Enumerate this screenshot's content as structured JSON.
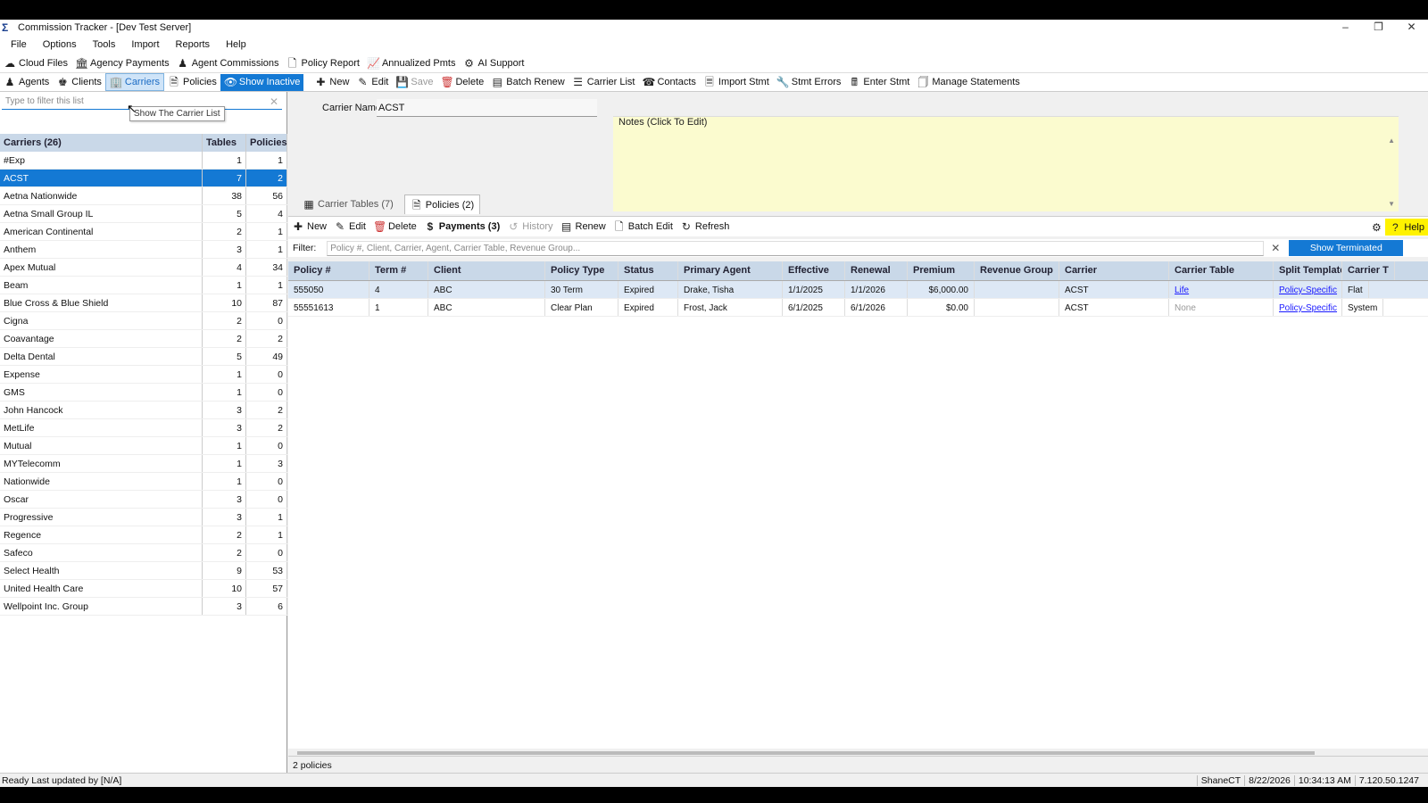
{
  "window": {
    "title": "Commission Tracker - [Dev Test Server]",
    "controls": [
      "–",
      "❐",
      "✕"
    ]
  },
  "menu": [
    "File",
    "Options",
    "Tools",
    "Import",
    "Reports",
    "Help"
  ],
  "toolbar1": [
    "Cloud Files",
    "Agency Payments",
    "Agent Commissions",
    "Policy Report",
    "Annualized Pmts",
    "AI Support"
  ],
  "toolbar2": {
    "left": [
      "Agents",
      "Clients",
      "Carriers",
      "Policies",
      "Show Inactive"
    ],
    "right": [
      "New",
      "Edit",
      "Save",
      "Delete",
      "Batch Renew",
      "Carrier List",
      "Contacts",
      "Import Stmt",
      "Stmt Errors",
      "Enter Stmt",
      "Manage Statements"
    ]
  },
  "left_panel": {
    "filter_placeholder": "Type to filter this list",
    "tooltip": "Show The Carrier List",
    "headers": [
      "Carriers (26)",
      "Tables",
      "Policies"
    ],
    "selected_index": 1,
    "rows": [
      [
        "#Exp",
        "1",
        "1"
      ],
      [
        "ACST",
        "7",
        "2"
      ],
      [
        "Aetna Nationwide",
        "38",
        "56"
      ],
      [
        "Aetna Small Group IL",
        "5",
        "4"
      ],
      [
        "American Continental",
        "2",
        "1"
      ],
      [
        "Anthem",
        "3",
        "1"
      ],
      [
        "Apex Mutual",
        "4",
        "34"
      ],
      [
        "Beam",
        "1",
        "1"
      ],
      [
        "Blue Cross & Blue Shield",
        "10",
        "87"
      ],
      [
        "Cigna",
        "2",
        "0"
      ],
      [
        "Coavantage",
        "2",
        "2"
      ],
      [
        "Delta Dental",
        "5",
        "49"
      ],
      [
        "Expense",
        "1",
        "0"
      ],
      [
        "GMS",
        "1",
        "0"
      ],
      [
        "John Hancock",
        "3",
        "2"
      ],
      [
        "MetLife",
        "3",
        "2"
      ],
      [
        "Mutual",
        "1",
        "0"
      ],
      [
        "MYTelecomm",
        "1",
        "3"
      ],
      [
        "Nationwide",
        "1",
        "0"
      ],
      [
        "Oscar",
        "3",
        "0"
      ],
      [
        "Progressive",
        "3",
        "1"
      ],
      [
        "Regence",
        "2",
        "1"
      ],
      [
        "Safeco",
        "2",
        "0"
      ],
      [
        "Select Health",
        "9",
        "53"
      ],
      [
        "United Health Care",
        "10",
        "57"
      ],
      [
        "Wellpoint Inc. Group",
        "3",
        "6"
      ]
    ]
  },
  "detail": {
    "carrier_name_label": "Carrier Name:",
    "carrier_name_value": "ACST",
    "notes_label": "Notes  (Click To Edit)",
    "tabs": [
      "Carrier Tables (7)",
      "Policies (2)"
    ]
  },
  "policy_toolbar": [
    "New",
    "Edit",
    "Delete",
    "Payments (3)",
    "History",
    "Renew",
    "Batch Edit",
    "Refresh"
  ],
  "help_label": "Help",
  "filter": {
    "label": "Filter:",
    "placeholder": "Policy #, Client, Carrier, Agent, Carrier Table, Revenue Group...",
    "show_terminated": "Show Terminated"
  },
  "grid": {
    "headers": [
      "Policy #",
      "Term #",
      "Client",
      "Policy Type",
      "Status",
      "Primary Agent",
      "Effective",
      "Renewal",
      "Premium",
      "Revenue Group",
      "Carrier",
      "Carrier Table",
      "Split Template",
      "Carrier T"
    ],
    "rows": [
      [
        "555050",
        "4",
        "ABC",
        "30 Term",
        "Expired",
        "Drake, Tisha",
        "1/1/2025",
        "1/1/2026",
        "$6,000.00",
        "",
        "ACST",
        "Life",
        "Policy-Specific",
        "Flat"
      ],
      [
        "55551613",
        "1",
        "ABC",
        "Clear Plan",
        "Expired",
        "Frost, Jack",
        "6/1/2025",
        "6/1/2026",
        "$0.00",
        "",
        "ACST",
        "None",
        "Policy-Specific",
        "System"
      ]
    ],
    "footer": "2 policies"
  },
  "status": {
    "left": "Ready   Last updated by [N/A]",
    "user": "ShaneCT",
    "date": "8/22/2026",
    "time": "10:34:13 AM",
    "version": "7.120.50.1247"
  }
}
